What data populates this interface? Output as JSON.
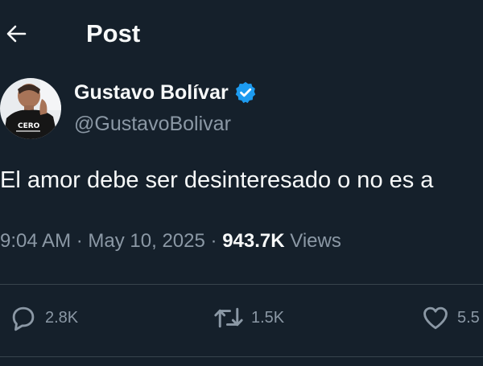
{
  "header": {
    "title": "Post"
  },
  "author": {
    "display_name": "Gustavo Bolívar",
    "handle": "@GustavoBolivar",
    "verified": true,
    "avatar_shirt_text": "CERO"
  },
  "post": {
    "text": "El amor debe ser desinteresado o no es a",
    "time": "9:04 AM",
    "date": "May 10, 2025",
    "views_count": "943.7K",
    "views_label": "Views"
  },
  "actions": {
    "replies": "2.8K",
    "reposts": "1.5K",
    "likes": "5.5"
  },
  "colors": {
    "background": "#15202b",
    "text_primary": "#f7f9f9",
    "text_secondary": "#8b98a5",
    "verified_blue": "#1d9bf0",
    "divider": "#38444d"
  },
  "icons": {
    "back": "arrow-left-icon",
    "verified": "verified-badge-icon",
    "reply": "reply-bubble-icon",
    "repost": "repost-icon",
    "like": "heart-icon"
  }
}
